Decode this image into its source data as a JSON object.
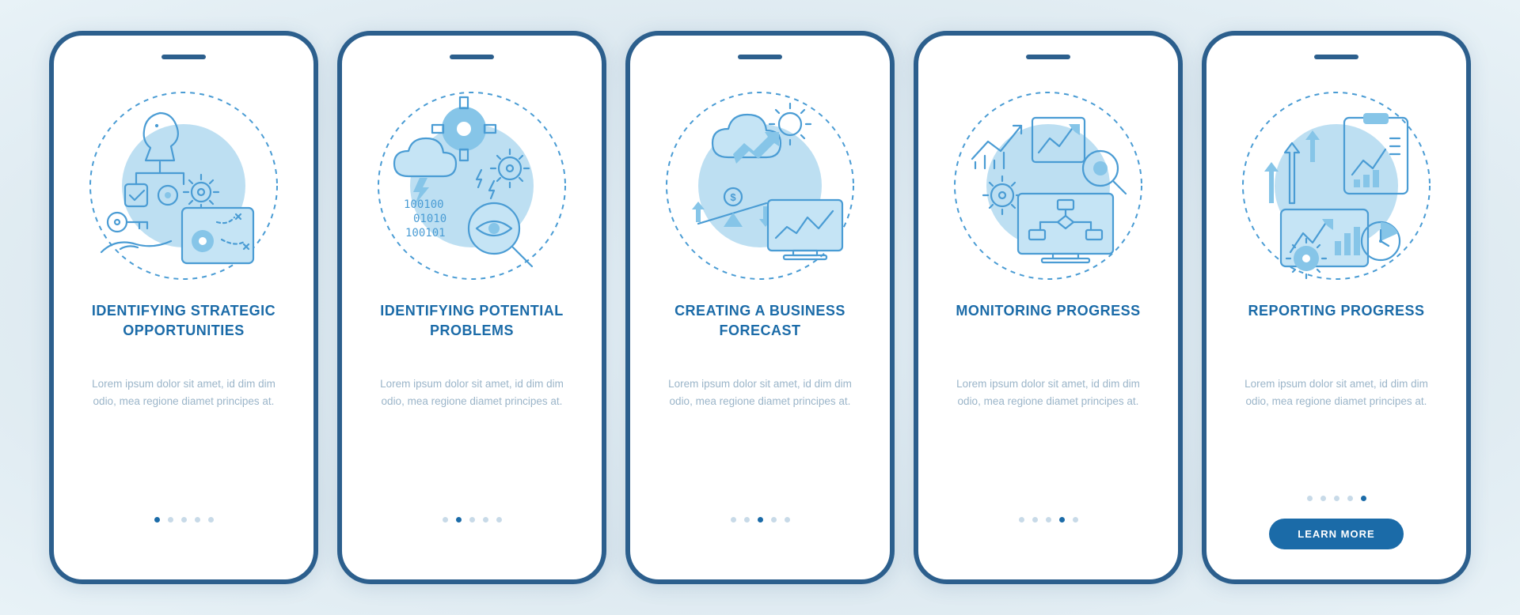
{
  "colors": {
    "accent": "#1b6ba8",
    "stroke": "#4a9cd4",
    "muted": "#9bb5c9",
    "dot_inactive": "#c8dae8"
  },
  "cta_label": "LEARN MORE",
  "slides": [
    {
      "title": "IDENTIFYING STRATEGIC OPPORTUNITIES",
      "desc": "Lorem ipsum dolor sit amet, id dim dim odio, mea regione diamet principes at.",
      "icon": "strategy-icon",
      "has_cta": false,
      "active_index": 0
    },
    {
      "title": "IDENTIFYING POTENTIAL PROBLEMS",
      "desc": "Lorem ipsum dolor sit amet, id dim dim odio, mea regione diamet principes at.",
      "icon": "problems-icon",
      "has_cta": false,
      "active_index": 1
    },
    {
      "title": "CREATING A BUSINESS FORECAST",
      "desc": "Lorem ipsum dolor sit amet, id dim dim odio, mea regione diamet principes at.",
      "icon": "forecast-icon",
      "has_cta": false,
      "active_index": 2
    },
    {
      "title": "MONITORING PROGRESS",
      "desc": "Lorem ipsum dolor sit amet, id dim dim odio, mea regione diamet principes at.",
      "icon": "monitoring-icon",
      "has_cta": false,
      "active_index": 3
    },
    {
      "title": "REPORTING PROGRESS",
      "desc": "Lorem ipsum dolor sit amet, id dim dim odio, mea regione diamet principes at.",
      "icon": "reporting-icon",
      "has_cta": true,
      "active_index": 4
    }
  ],
  "total_dots": 5
}
